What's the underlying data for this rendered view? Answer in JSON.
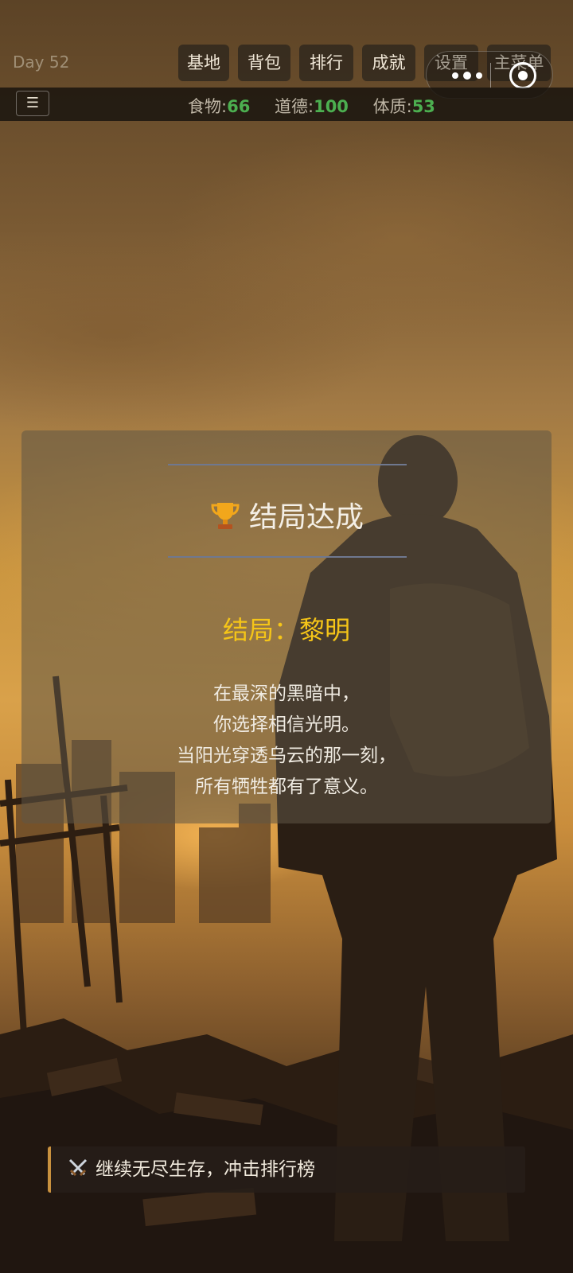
{
  "hud": {
    "day": "Day 52",
    "nav": [
      "基地",
      "背包",
      "排行",
      "成就",
      "设置",
      "主菜单"
    ],
    "menu_icon": "☰",
    "stats": [
      {
        "label": "食物:",
        "value": "66"
      },
      {
        "label": "道德:",
        "value": "100"
      },
      {
        "label": "体质:",
        "value": "53"
      }
    ],
    "stat_value_color": "#4caf50"
  },
  "ending_panel": {
    "title": "结局达成",
    "title_icon": "trophy-icon",
    "ending_name": "结局：黎明",
    "ending_color": "#f5c518",
    "lines": [
      "在最深的黑暗中，",
      "你选择相信光明。",
      "当阳光穿透乌云的那一刻，",
      "所有牺牲都有了意义。"
    ]
  },
  "continue": {
    "icon": "crossed-swords-icon",
    "label": "继续无尽生存，冲击排行榜",
    "accent_color": "#c9913e"
  }
}
